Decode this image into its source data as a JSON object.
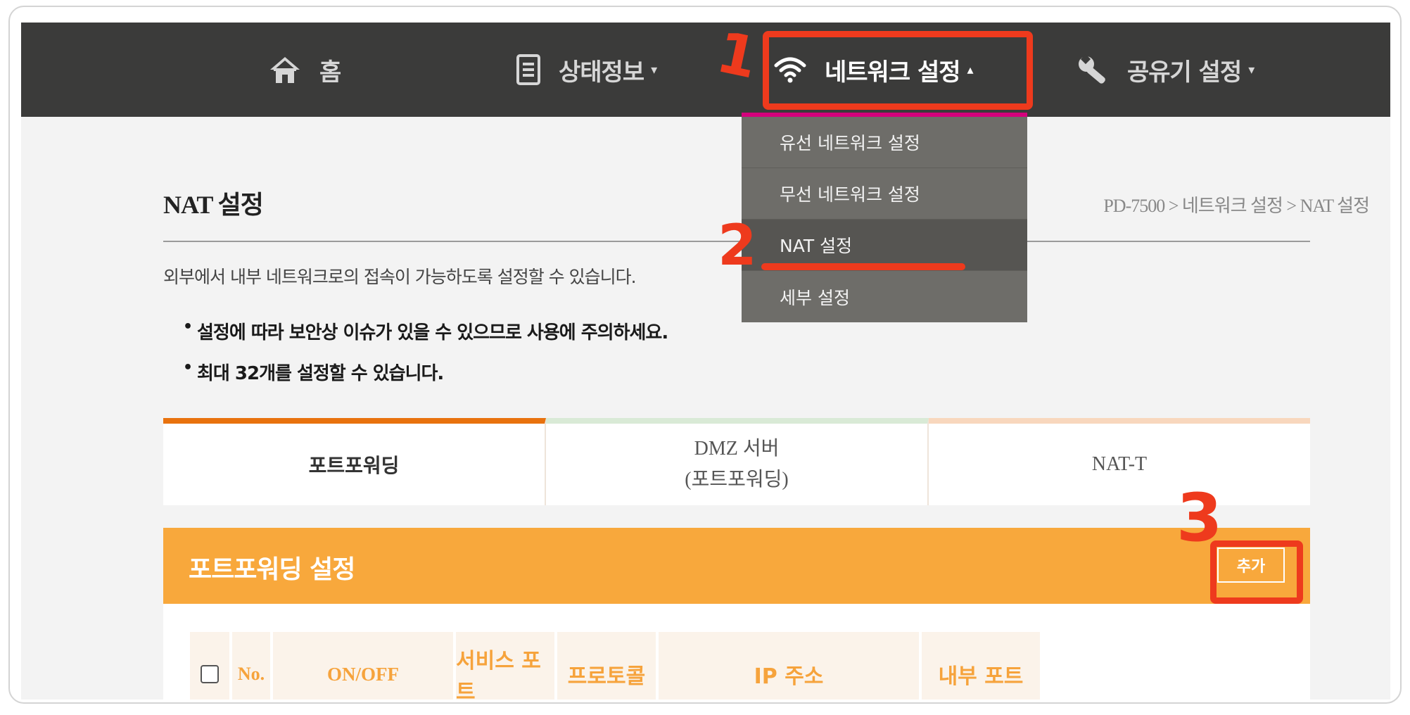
{
  "nav": {
    "home": "홈",
    "status": "상태정보",
    "network": "네트워크 설정",
    "router": "공유기 설정",
    "caret_down": "▾",
    "caret_up": "▴"
  },
  "dropdown": [
    "유선 네트워크 설정",
    "무선 네트워크 설정",
    "NAT 설정",
    "세부 설정"
  ],
  "page": {
    "title": "NAT 설정",
    "breadcrumb": "PD-7500 > 네트워크 설정 > NAT 설정",
    "description": "외부에서 내부 네트워크로의 접속이 가능하도록 설정할 수 있습니다.",
    "note1": "설정에 따라 보안상 이슈가 있을 수 있으므로 사용에 주의하세요.",
    "note2": "최대 32개를 설정할 수 있습니다."
  },
  "tabs": {
    "tab1": "포트포워딩",
    "tab2_line1": "DMZ 서버",
    "tab2_line2": "(포트포워딩)",
    "tab3": "NAT-T"
  },
  "section": {
    "title": "포트포워딩 설정",
    "add_button": "추가"
  },
  "table": {
    "headers": [
      "No.",
      "ON/OFF",
      "서비스 포트",
      "프로토콜",
      "IP 주소",
      "내부 포트"
    ]
  },
  "annotations": {
    "step1": "1",
    "step2": "2",
    "step3": "3",
    "color": "#ee3a1d"
  },
  "colors": {
    "nav_bg": "#3b3b3a",
    "accent_orange": "#f8a83c",
    "tab_active": "#e8720e",
    "dropdown_bg": "#6e6d69",
    "dropdown_border": "#d4007c"
  }
}
